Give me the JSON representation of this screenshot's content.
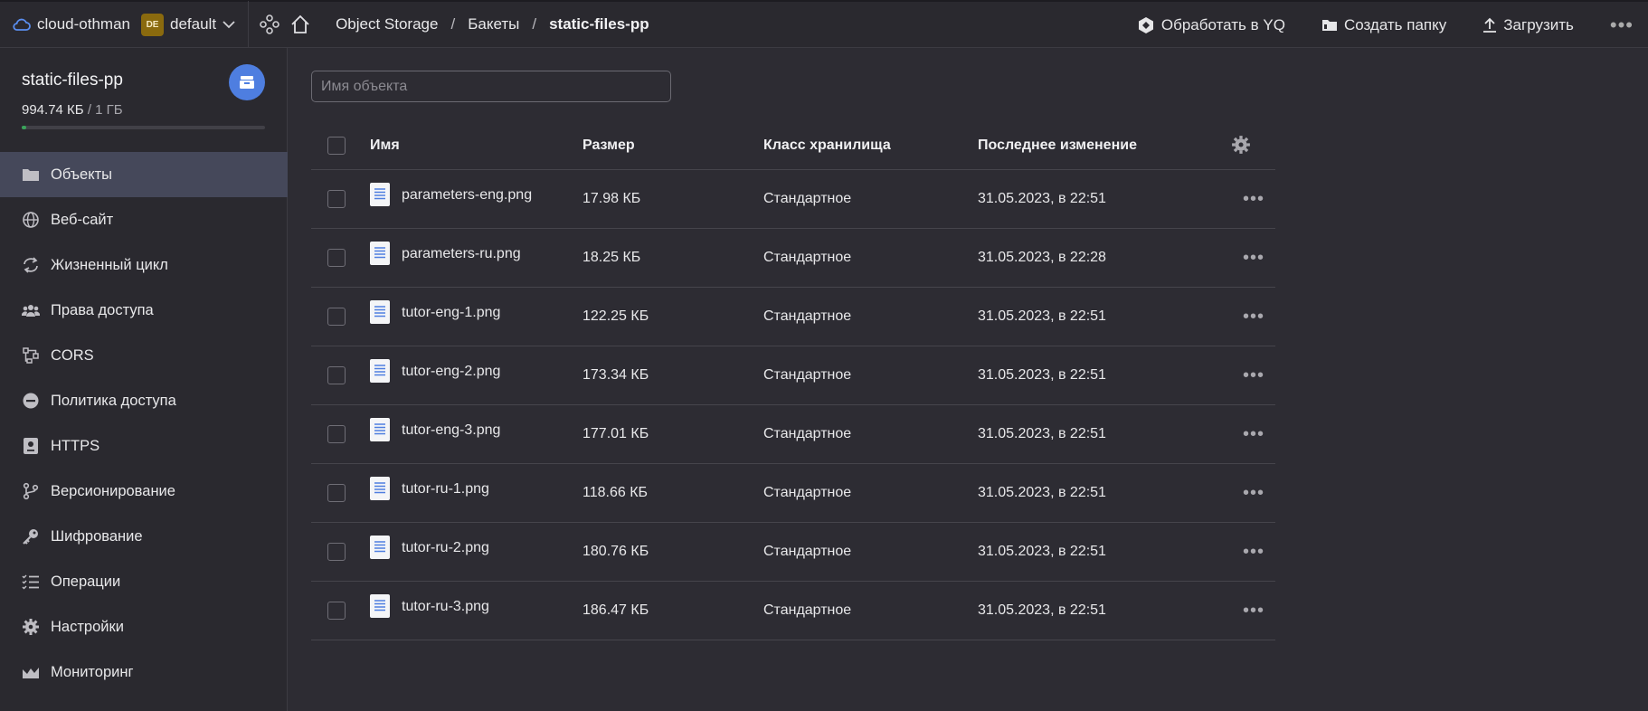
{
  "topbar": {
    "cloud_name": "cloud-othman",
    "folder_badge": "DE",
    "folder_name": "default",
    "breadcrumbs": [
      "Object Storage",
      "Бакеты",
      "static-files-pp"
    ],
    "actions": {
      "yq": "Обработать в YQ",
      "create_folder": "Создать папку",
      "upload": "Загрузить"
    }
  },
  "sidebar": {
    "bucket_name": "static-files-pp",
    "usage_used": "994.74 КБ",
    "usage_total": "/ 1 ГБ",
    "usage_fraction": 0.001,
    "items": [
      {
        "label": "Объекты",
        "icon": "folder-icon",
        "active": true
      },
      {
        "label": "Веб-сайт",
        "icon": "globe-icon"
      },
      {
        "label": "Жизненный цикл",
        "icon": "lifecycle-icon"
      },
      {
        "label": "Права доступа",
        "icon": "users-icon"
      },
      {
        "label": "CORS",
        "icon": "cors-icon"
      },
      {
        "label": "Политика доступа",
        "icon": "policy-icon"
      },
      {
        "label": "HTTPS",
        "icon": "certificate-icon"
      },
      {
        "label": "Версионирование",
        "icon": "branch-icon"
      },
      {
        "label": "Шифрование",
        "icon": "key-icon"
      },
      {
        "label": "Операции",
        "icon": "list-check-icon"
      },
      {
        "label": "Настройки",
        "icon": "gear-icon"
      },
      {
        "label": "Мониторинг",
        "icon": "chart-icon"
      }
    ]
  },
  "search": {
    "placeholder": "Имя объекта"
  },
  "table": {
    "headers": {
      "name": "Имя",
      "size": "Размер",
      "class": "Класс хранилища",
      "modified": "Последнее изменение"
    },
    "rows": [
      {
        "name": "parameters-eng.png",
        "size": "17.98 КБ",
        "class": "Стандартное",
        "modified": "31.05.2023, в 22:51"
      },
      {
        "name": "parameters-ru.png",
        "size": "18.25 КБ",
        "class": "Стандартное",
        "modified": "31.05.2023, в 22:28"
      },
      {
        "name": "tutor-eng-1.png",
        "size": "122.25 КБ",
        "class": "Стандартное",
        "modified": "31.05.2023, в 22:51"
      },
      {
        "name": "tutor-eng-2.png",
        "size": "173.34 КБ",
        "class": "Стандартное",
        "modified": "31.05.2023, в 22:51"
      },
      {
        "name": "tutor-eng-3.png",
        "size": "177.01 КБ",
        "class": "Стандартное",
        "modified": "31.05.2023, в 22:51"
      },
      {
        "name": "tutor-ru-1.png",
        "size": "118.66 КБ",
        "class": "Стандартное",
        "modified": "31.05.2023, в 22:51"
      },
      {
        "name": "tutor-ru-2.png",
        "size": "180.76 КБ",
        "class": "Стандартное",
        "modified": "31.05.2023, в 22:51"
      },
      {
        "name": "tutor-ru-3.png",
        "size": "186.47 КБ",
        "class": "Стандартное",
        "modified": "31.05.2023, в 22:51"
      }
    ]
  },
  "colors": {
    "accent": "#4e7ee0",
    "active_nav": "#45485a",
    "usage_bar": "#3aa35a"
  }
}
